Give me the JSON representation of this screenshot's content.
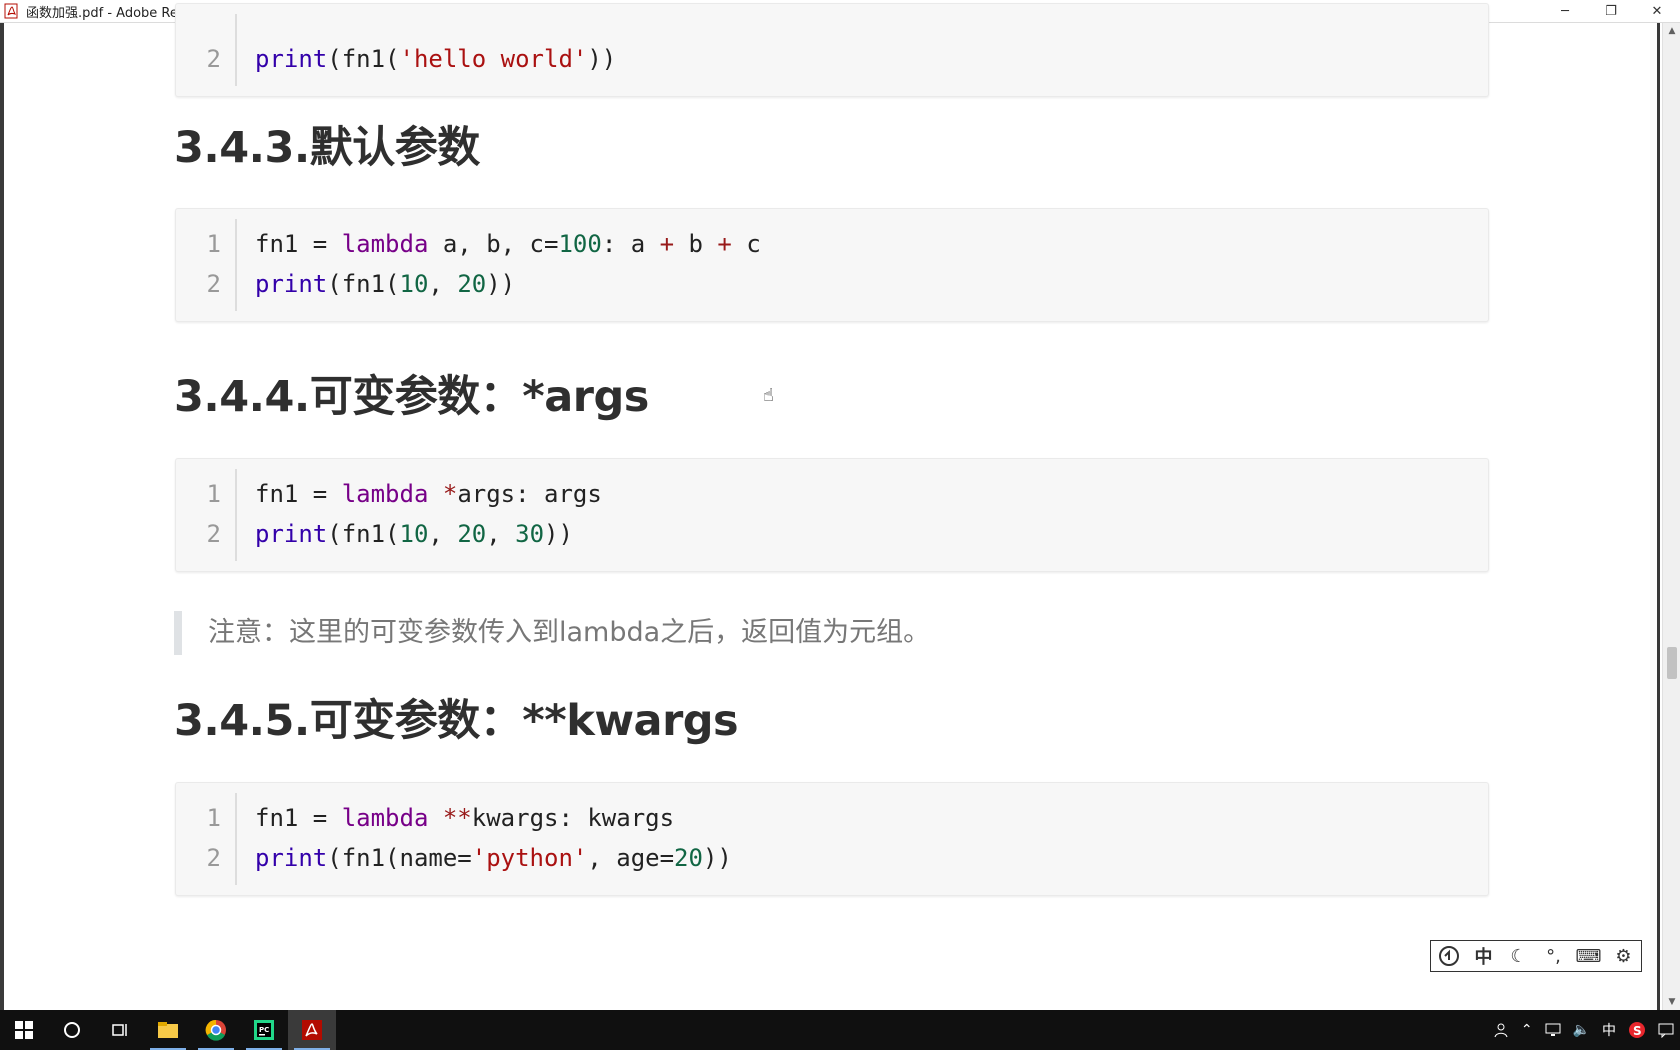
{
  "window": {
    "title": "函数加强.pdf - Adobe Reader",
    "controls": {
      "minimize": "─",
      "restore": "❐",
      "close": "✕"
    }
  },
  "document": {
    "top_code": {
      "lines": [
        {
          "num": "2",
          "tokens": [
            [
              "fn",
              "print"
            ],
            [
              "p",
              "(fn1("
            ],
            [
              "str",
              "'hello world'"
            ],
            [
              "p",
              "))"
            ]
          ]
        }
      ]
    },
    "sections": [
      {
        "heading": "3.4.3.默认参数",
        "code": [
          {
            "num": "1",
            "tokens": [
              [
                "p",
                "fn1 = "
              ],
              [
                "kw",
                "lambda"
              ],
              [
                "p",
                " a, b, c="
              ],
              [
                "num",
                "100"
              ],
              [
                "p",
                ": a "
              ],
              [
                "op",
                "+"
              ],
              [
                "p",
                " b "
              ],
              [
                "op",
                "+"
              ],
              [
                "p",
                " c"
              ]
            ]
          },
          {
            "num": "2",
            "tokens": [
              [
                "fn",
                "print"
              ],
              [
                "p",
                "(fn1("
              ],
              [
                "num",
                "10"
              ],
              [
                "p",
                ", "
              ],
              [
                "num",
                "20"
              ],
              [
                "p",
                "))"
              ]
            ]
          }
        ]
      },
      {
        "heading": "3.4.4.可变参数：*args",
        "code": [
          {
            "num": "1",
            "tokens": [
              [
                "p",
                "fn1 = "
              ],
              [
                "kw",
                "lambda"
              ],
              [
                "p",
                " "
              ],
              [
                "op",
                "*"
              ],
              [
                "p",
                "args: args"
              ]
            ]
          },
          {
            "num": "2",
            "tokens": [
              [
                "fn",
                "print"
              ],
              [
                "p",
                "(fn1("
              ],
              [
                "num",
                "10"
              ],
              [
                "p",
                ", "
              ],
              [
                "num",
                "20"
              ],
              [
                "p",
                ", "
              ],
              [
                "num",
                "30"
              ],
              [
                "p",
                "))"
              ]
            ]
          }
        ],
        "note": "注意：这里的可变参数传入到lambda之后，返回值为元组。"
      },
      {
        "heading": "3.4.5.可变参数：**kwargs",
        "code": [
          {
            "num": "1",
            "tokens": [
              [
                "p",
                "fn1 = "
              ],
              [
                "kw",
                "lambda"
              ],
              [
                "p",
                " "
              ],
              [
                "op",
                "**"
              ],
              [
                "p",
                "kwargs: kwargs"
              ]
            ]
          },
          {
            "num": "2",
            "tokens": [
              [
                "fn",
                "print"
              ],
              [
                "p",
                "(fn1(name="
              ],
              [
                "str",
                "'python'"
              ],
              [
                "p",
                ", age="
              ],
              [
                "num",
                "20"
              ],
              [
                "p",
                "))"
              ]
            ]
          }
        ]
      }
    ]
  },
  "ime_toolbar": {
    "items": [
      "ime-logo-icon",
      "中",
      "moon-icon",
      "°,",
      "keyboard-icon",
      "gear-icon"
    ]
  },
  "taskbar": {
    "items": [
      "start-icon",
      "cortana-icon",
      "task-view-icon",
      "file-explorer-icon",
      "chrome-icon",
      "pycharm-icon",
      "adobe-reader-icon"
    ],
    "tray": {
      "ime_label": "中"
    }
  },
  "colors": {
    "keyword": "#770088",
    "builtin": "#3300aa",
    "string": "#aa1111",
    "number": "#116644",
    "operator": "#981a1a"
  }
}
